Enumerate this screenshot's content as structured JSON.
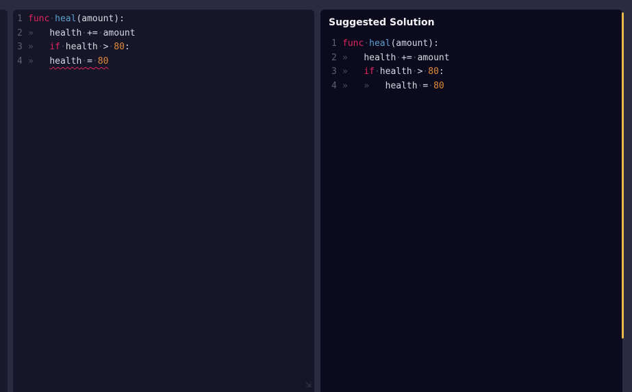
{
  "editor": {
    "lines": [
      {
        "num": "1"
      },
      {
        "num": "2"
      },
      {
        "num": "3"
      },
      {
        "num": "4"
      }
    ],
    "tokens": {
      "func": "func",
      "heal": "heal",
      "params": "(amount):",
      "health": "health",
      "plus_eq": "+=",
      "amount": "amount",
      "if": "if",
      "gt": ">",
      "eighty": "80",
      "colon": ":",
      "eq": "=",
      "tab_glyph": "»",
      "space_glyph": "·"
    },
    "error_line": "4"
  },
  "solution": {
    "title": "Suggested Solution",
    "lines": [
      {
        "num": "1"
      },
      {
        "num": "2"
      },
      {
        "num": "3"
      },
      {
        "num": "4"
      }
    ]
  },
  "colors": {
    "keyword": "#e0245e",
    "function": "#5d9fcf",
    "number": "#e08a38",
    "scrollbar": "#e8b84a"
  },
  "icons": {
    "resize": "resize-handle-icon"
  }
}
